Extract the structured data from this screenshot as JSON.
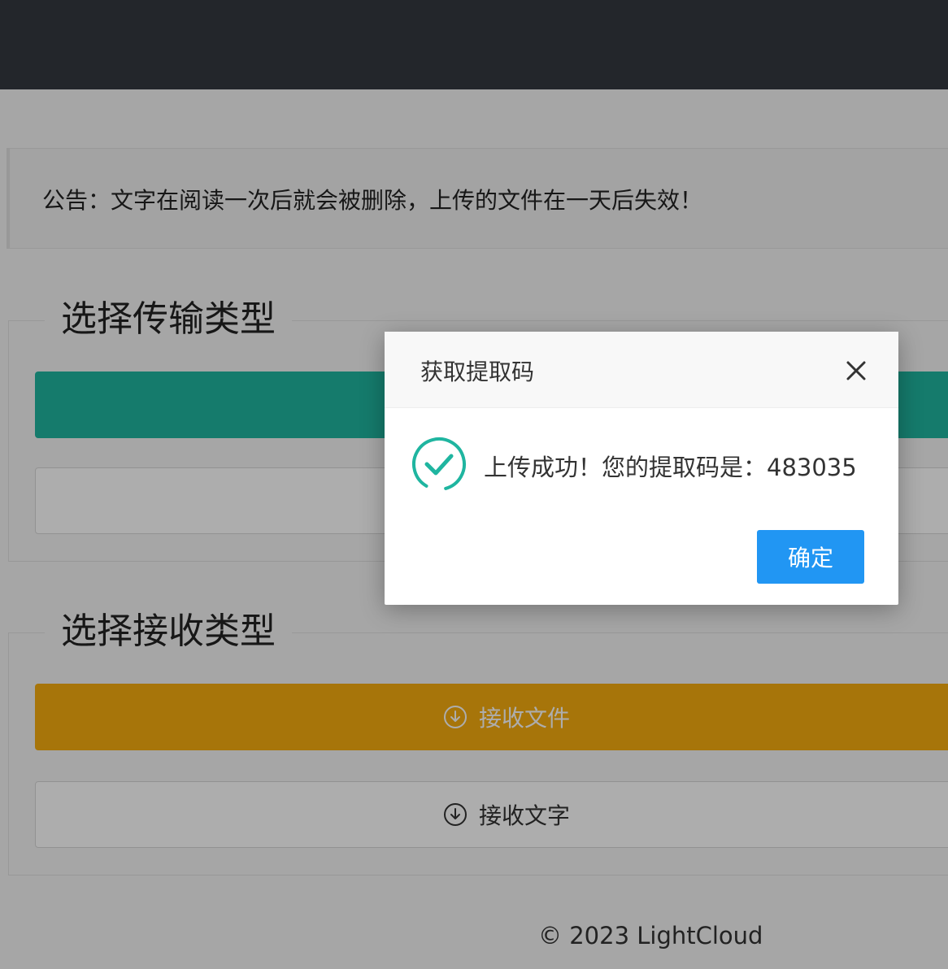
{
  "notice": {
    "text": "公告：文字在阅读一次后就会被删除，上传的文件在一天后失效！"
  },
  "send_section": {
    "title": "选择传输类型"
  },
  "receive_section": {
    "title": "选择接收类型",
    "receive_file_label": "接收文件",
    "receive_text_label": "接收文字",
    "button_icon": "download-circle-icon"
  },
  "footer": {
    "text": "© 2023 LightCloud"
  },
  "dialog": {
    "title": "获取提取码",
    "close_icon": "close-icon",
    "status_icon": "success-check-icon",
    "message": "上传成功！您的提取码是：483035",
    "confirm_label": "确定"
  },
  "colors": {
    "topbar": "#23262b",
    "send_button": "#1fb5a0",
    "receive_file_button": "#f7ad10",
    "confirm_button": "#2196f3",
    "success_icon": "#1fb5a0"
  }
}
